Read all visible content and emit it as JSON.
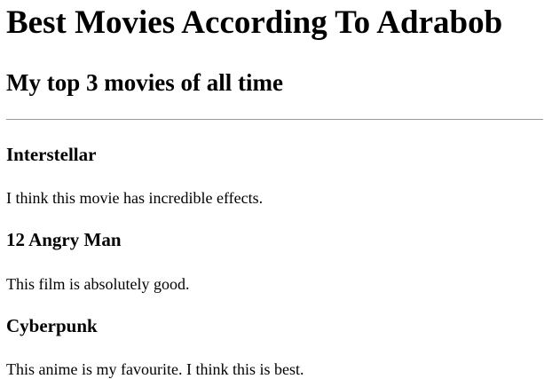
{
  "page": {
    "title": "Best Movies According To Adrabob",
    "subtitle": "My top 3 movies of all time"
  },
  "movies": [
    {
      "title": "Interstellar",
      "description": "I think this movie has incredible effects."
    },
    {
      "title": "12 Angry Man",
      "description": "This film is absolutely good."
    },
    {
      "title": "Cyberpunk",
      "description": "This anime is my favourite. I think this is best."
    }
  ]
}
